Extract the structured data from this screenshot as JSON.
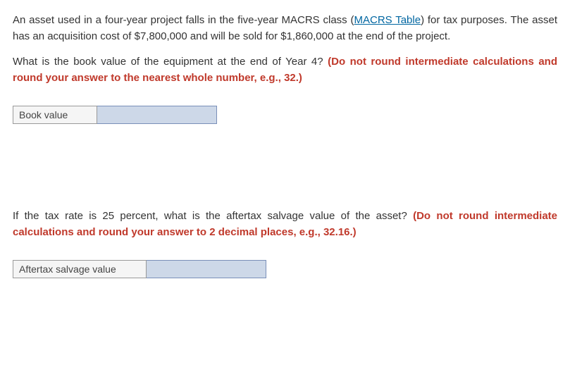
{
  "p1_part1": "An asset used in a four-year project falls in the five-year MACRS class (",
  "p1_link": "MACRS Table",
  "p1_part2": ") for tax purposes. The asset has an acquisition cost of $7,800,000 and will be sold for $1,860,000 at the end of the project.",
  "q1_text": "What is the book value of the equipment at the end of Year 4? ",
  "q1_instruction": "(Do not round intermediate calculations and round your answer to the nearest whole number, e.g., 32.)",
  "input1_label": "Book value",
  "input1_value": "",
  "q2_text": "If the tax rate is 25 percent, what is the aftertax salvage value of the asset? ",
  "q2_instruction": "(Do not round intermediate calculations and round your answer to 2 decimal places, e.g., 32.16.)",
  "input2_label": "Aftertax salvage value",
  "input2_value": ""
}
